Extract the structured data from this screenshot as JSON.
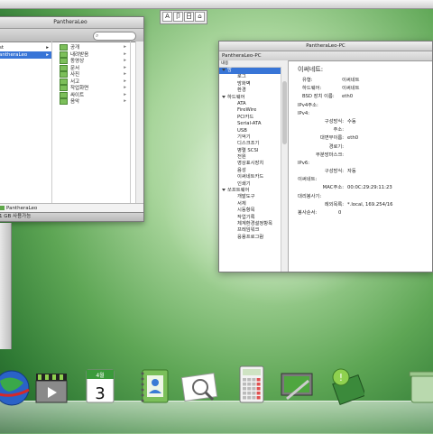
{
  "colors": {
    "selection": "#3875d7",
    "folder_green": "#7cbf5a",
    "desktop_green": "#5ea655"
  },
  "input_tray": [
    "A",
    "卩",
    "日",
    "⌂"
  ],
  "finder": {
    "title": "PantheraLeo",
    "sidebar": [
      {
        "label": "st",
        "selected": false
      },
      {
        "label": "antheraLeo",
        "selected": true
      }
    ],
    "folders": [
      "공개",
      "내려받음",
      "동영상",
      "문서",
      "사진",
      "서고",
      "작업화면",
      "싸이트",
      "음악"
    ],
    "path_label": "PantheraLeo",
    "status_text": "1 GB 사용가능"
  },
  "sysinfo": {
    "title": "PantheraLeo-PC",
    "subtitle": "PantheraLeo-PC",
    "tree_header": "내용",
    "tree": [
      {
        "label": "망",
        "level": "cat",
        "selected": true
      },
      {
        "label": "로그",
        "level": "sub"
      },
      {
        "label": "방화벽",
        "level": "sub"
      },
      {
        "label": "환경",
        "level": "sub"
      },
      {
        "label": "하드웨어",
        "level": "cat"
      },
      {
        "label": "ATA",
        "level": "sub"
      },
      {
        "label": "FireWire",
        "level": "sub"
      },
      {
        "label": "PCI카드",
        "level": "sub"
      },
      {
        "label": "Serial-ATA",
        "level": "sub"
      },
      {
        "label": "USB",
        "level": "sub"
      },
      {
        "label": "기억기",
        "level": "sub"
      },
      {
        "label": "디스크조기",
        "level": "sub"
      },
      {
        "label": "병렬 SCSI",
        "level": "sub"
      },
      {
        "label": "전원",
        "level": "sub"
      },
      {
        "label": "영상표시장치",
        "level": "sub"
      },
      {
        "label": "음성",
        "level": "sub"
      },
      {
        "label": "이써네트카드",
        "level": "sub"
      },
      {
        "label": "인쇄기",
        "level": "sub"
      },
      {
        "label": "쏘프트웨어",
        "level": "cat"
      },
      {
        "label": "개발도구",
        "level": "sub"
      },
      {
        "label": "서체",
        "level": "sub"
      },
      {
        "label": "시동항목",
        "level": "sub"
      },
      {
        "label": "작업기록",
        "level": "sub"
      },
      {
        "label": "체계환경설정항목",
        "level": "sub"
      },
      {
        "label": "프레임워크",
        "level": "sub"
      },
      {
        "label": "응용프로그람",
        "level": "sub"
      }
    ],
    "detail_heading": "이써네트:",
    "detail": [
      {
        "k": "유형:",
        "v": "이써네트",
        "indent": 1
      },
      {
        "k": "하드웨어:",
        "v": "이써네트",
        "indent": 1
      },
      {
        "k": "BSD 장치 이름:",
        "v": "eth0",
        "indent": 1
      },
      {
        "k": "IPv4주소:",
        "v": "",
        "indent": 0
      },
      {
        "k": "IPv4:",
        "v": "",
        "indent": 0
      },
      {
        "k": "구성방식:",
        "v": "수동",
        "indent": 2
      },
      {
        "k": "주소:",
        "v": "",
        "indent": 2
      },
      {
        "k": "대면부이름:",
        "v": "eth0",
        "indent": 2
      },
      {
        "k": "경로기:",
        "v": "",
        "indent": 2
      },
      {
        "k": "부분망마스크:",
        "v": "",
        "indent": 2
      },
      {
        "k": "IPv6:",
        "v": "",
        "indent": 0
      },
      {
        "k": "구성방식:",
        "v": "자동",
        "indent": 2
      },
      {
        "k": "이써네트:",
        "v": "",
        "indent": 0
      },
      {
        "k": "MAC주소:",
        "v": "00:0C:29:29:11:23",
        "indent": 2
      },
      {
        "k": "대리봉사기:",
        "v": "",
        "indent": 0
      },
      {
        "k": "례외목록:",
        "v": "*.local, 169.254/16",
        "indent": 2
      },
      {
        "k": "봉사순서:",
        "v": "0",
        "indent": 0
      }
    ]
  },
  "dock": [
    {
      "name": "globe-browser-icon",
      "date_month": "",
      "date_day": ""
    },
    {
      "name": "movie-clapper-icon",
      "date_month": "",
      "date_day": ""
    },
    {
      "name": "calendar-icon",
      "date_month": "4월",
      "date_day": "3"
    },
    {
      "name": "address-book-icon",
      "date_month": "",
      "date_day": ""
    },
    {
      "name": "image-viewer-icon",
      "date_month": "",
      "date_day": ""
    },
    {
      "name": "calculator-icon",
      "date_month": "",
      "date_day": ""
    },
    {
      "name": "system-preferences-icon",
      "date_month": "",
      "date_day": ""
    },
    {
      "name": "notes-icon",
      "date_month": "",
      "date_day": ""
    },
    {
      "name": "trash-icon",
      "date_month": "",
      "date_day": ""
    }
  ]
}
